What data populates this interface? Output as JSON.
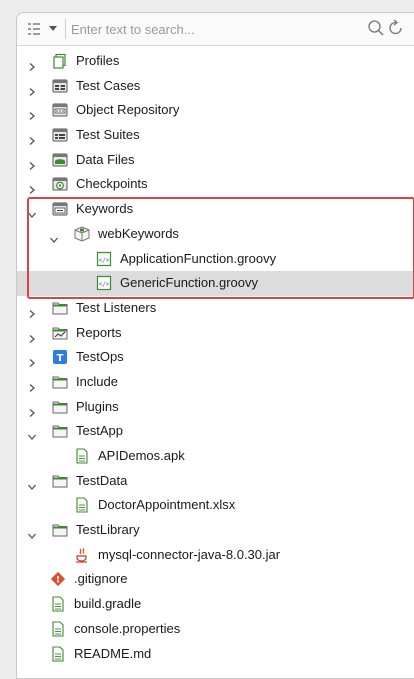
{
  "search": {
    "placeholder": "Enter text to search..."
  },
  "colors": {
    "highlight": "#d64545",
    "selected_row": "#dcdcdc",
    "folder": "#3d8a2f"
  },
  "tree": [
    {
      "label": "Profiles",
      "icon": "profiles-icon",
      "chevron": "right",
      "level": 0
    },
    {
      "label": "Test Cases",
      "icon": "test-cases-icon",
      "chevron": "right",
      "level": 0
    },
    {
      "label": "Object Repository",
      "icon": "object-repository-icon",
      "chevron": "right",
      "level": 0
    },
    {
      "label": "Test Suites",
      "icon": "test-suites-icon",
      "chevron": "right",
      "level": 0
    },
    {
      "label": "Data Files",
      "icon": "data-files-icon",
      "chevron": "right",
      "level": 0
    },
    {
      "label": "Checkpoints",
      "icon": "checkpoints-icon",
      "chevron": "right",
      "level": 0
    },
    {
      "label": "Keywords",
      "icon": "keywords-folder-icon",
      "chevron": "down",
      "level": 0
    },
    {
      "label": "webKeywords",
      "icon": "package-icon",
      "chevron": "down",
      "level": 1
    },
    {
      "label": "ApplicationFunction.groovy",
      "icon": "groovy-file-icon",
      "chevron": "none",
      "level": 2
    },
    {
      "label": "GenericFunction.groovy",
      "icon": "groovy-file-icon",
      "chevron": "none",
      "level": 2,
      "selected": true
    },
    {
      "label": "Test Listeners",
      "icon": "folder-icon",
      "chevron": "right",
      "level": 0
    },
    {
      "label": "Reports",
      "icon": "reports-icon",
      "chevron": "right",
      "level": 0
    },
    {
      "label": "TestOps",
      "icon": "testops-icon",
      "chevron": "right",
      "level": 0
    },
    {
      "label": "Include",
      "icon": "folder-icon",
      "chevron": "right",
      "level": 0
    },
    {
      "label": "Plugins",
      "icon": "folder-icon",
      "chevron": "right",
      "level": 0
    },
    {
      "label": "TestApp",
      "icon": "folder-icon",
      "chevron": "down",
      "level": 0
    },
    {
      "label": "APIDemos.apk",
      "icon": "file-icon",
      "chevron": "none",
      "level": 1
    },
    {
      "label": "TestData",
      "icon": "folder-icon",
      "chevron": "down",
      "level": 0
    },
    {
      "label": "DoctorAppointment.xlsx",
      "icon": "file-icon",
      "chevron": "none",
      "level": 1
    },
    {
      "label": "TestLibrary",
      "icon": "folder-icon",
      "chevron": "down",
      "level": 0
    },
    {
      "label": "mysql-connector-java-8.0.30.jar",
      "icon": "java-jar-icon",
      "chevron": "none",
      "level": 1
    },
    {
      "label": ".gitignore",
      "icon": "git-icon",
      "chevron": "none",
      "level": 0,
      "no_indent_chevron": true
    },
    {
      "label": "build.gradle",
      "icon": "file-icon",
      "chevron": "none",
      "level": 0,
      "no_indent_chevron": true
    },
    {
      "label": "console.properties",
      "icon": "file-icon",
      "chevron": "none",
      "level": 0,
      "no_indent_chevron": true
    },
    {
      "label": "README.md",
      "icon": "file-icon",
      "chevron": "none",
      "level": 0,
      "no_indent_chevron": true
    }
  ]
}
